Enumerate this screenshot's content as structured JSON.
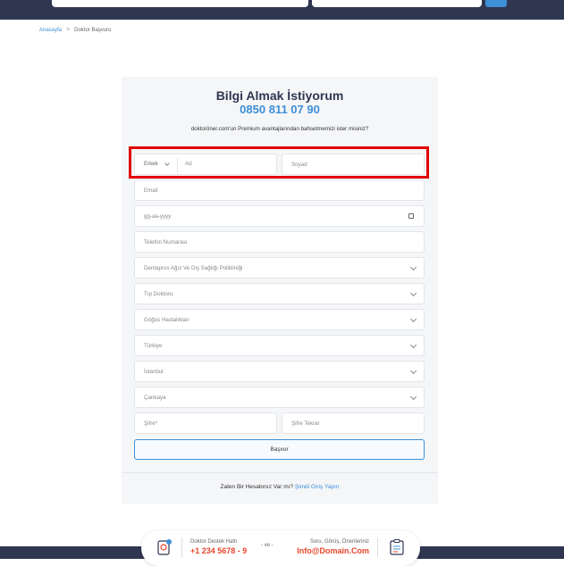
{
  "breadcrumb": {
    "home": "Anasayfa",
    "separator": ">",
    "current": "Doktor Başvuru"
  },
  "form": {
    "title": "Bilgi Almak İstiyorum",
    "phone": "0850 811 07 90",
    "description": "doktoröner.com'un Premium avantajlarından bahsetmemizi ister misiniz?",
    "gender_value": "Erkek",
    "first_name_placeholder": "Ad",
    "last_name_placeholder": "Soyad",
    "email_placeholder": "Email",
    "date_placeholder": "gg-aa-yyyy",
    "phone_placeholder": "Telefon Numarası",
    "clinic_value": "Dentapros Ağız Ve Diş Sağlığı Polikliniği",
    "specialty_value": "Tıp Doktoru",
    "subspecialty_value": "Göğüs Hastalıkları",
    "country_value": "Türkiye",
    "city_value": "İstanbul",
    "district_value": "Çankaya",
    "password_placeholder": "Şifre*",
    "password_repeat_placeholder": "Şifre Tekrar",
    "submit_label": "Başvur",
    "login_prompt": "Zaten Bir Hesabınız Var mı?",
    "login_link": "Şimdi Giriş Yapın"
  },
  "footer": {
    "support_label": "Doktor Destek Hattı",
    "support_number": "+1 234 5678 - 9",
    "and": "- ve -",
    "feedback_label": "Soru, Görüş, Önerileriniz",
    "feedback_email": "Info@Domain.Com"
  },
  "colors": {
    "navy": "#2f3650",
    "accent": "#3d8fd6",
    "highlight": "#e00000",
    "orange": "#e8452c"
  }
}
